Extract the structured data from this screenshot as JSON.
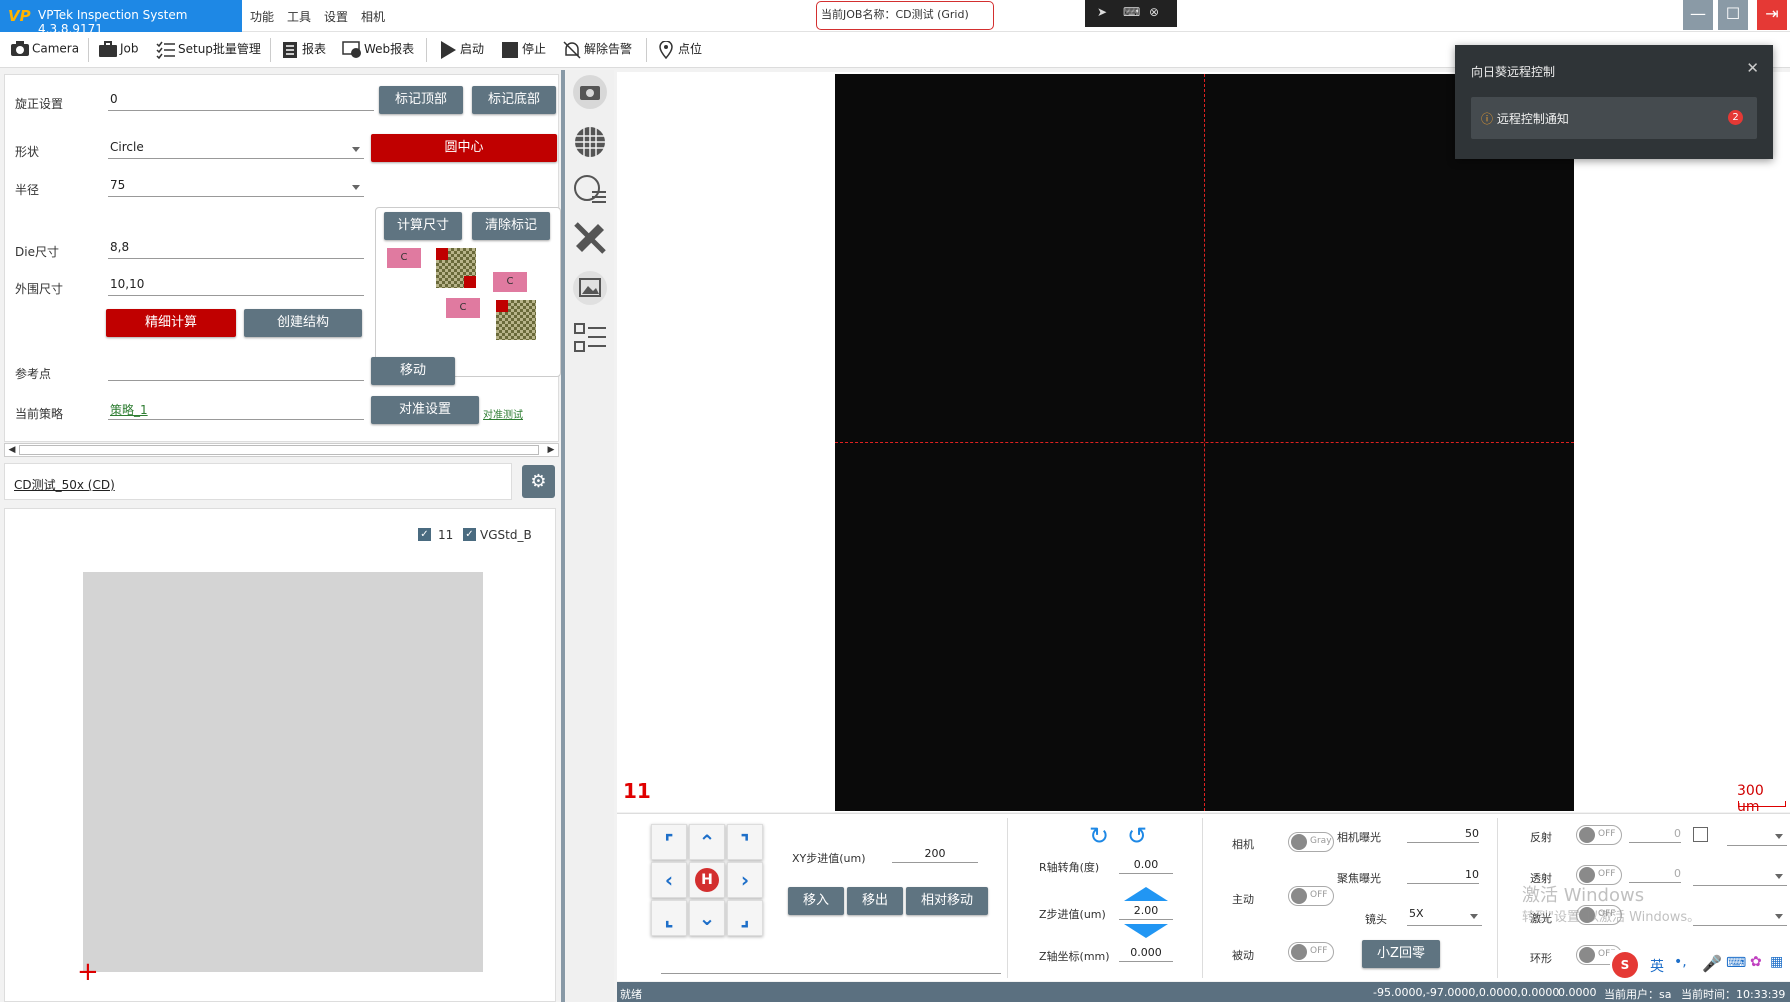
{
  "app": {
    "title": "VPTek Inspection System 4.3.8.9171",
    "logo": "VP",
    "menu": [
      "功能",
      "工具",
      "设置",
      "相机"
    ],
    "job_name": "当前JOB名称：CD测试 (Grid)"
  },
  "toolbar": {
    "items": [
      {
        "label": "Camera",
        "icon": "camera-icon"
      },
      {
        "label": "Job",
        "icon": "briefcase-icon"
      },
      {
        "label": "Setup批量管理",
        "icon": "checklist-icon"
      },
      {
        "label": "报表",
        "icon": "report-icon"
      },
      {
        "label": "Web报表",
        "icon": "web-report-icon"
      },
      {
        "label": "启动",
        "icon": "play-icon"
      },
      {
        "label": "停止",
        "icon": "stop-icon"
      },
      {
        "label": "解除告警",
        "icon": "bell-off-icon"
      },
      {
        "label": "点位",
        "icon": "map-pin-icon"
      }
    ]
  },
  "settings": {
    "rotation_label": "旋正设置",
    "rotation_value": "0",
    "mark_top": "标记顶部",
    "mark_bottom": "标记底部",
    "shape_label": "形状",
    "shape_value": "Circle",
    "circle_center": "圆中心",
    "radius_label": "半径",
    "radius_value": "75",
    "calc_size": "计算尺寸",
    "clear_marks": "清除标记",
    "die_label": "Die尺寸",
    "die_value": "8,8",
    "outer_label": "外围尺寸",
    "outer_value": "10,10",
    "fine_calc": "精细计算",
    "create_struct": "创建结构",
    "ref_label": "参考点",
    "ref_value": "",
    "move": "移动",
    "strategy_label": "当前策略",
    "strategy_value": "策略_1",
    "align_settings": "对准设置",
    "align_test": "对准测试",
    "diagram_tag": "C"
  },
  "recipe": {
    "path": "CD测试_50x (CD)"
  },
  "map": {
    "checkboxes": [
      {
        "label": "11",
        "checked": true
      },
      {
        "label": "VGStd_B",
        "checked": true
      }
    ]
  },
  "camera": {
    "site_number": "11",
    "scale_label": "300 um"
  },
  "notification": {
    "title": "向日葵远程控制",
    "item": "远程控制通知",
    "count": "2"
  },
  "motion": {
    "xy_step_label": "XY步进值(um)",
    "xy_step_value": "200",
    "move_in": "移入",
    "move_out": "移出",
    "relative_move": "相对移动",
    "r_angle_label": "R轴转角(度)",
    "r_angle_value": "0.00",
    "z_step_label": "Z步进值(um)",
    "z_step_value": "2.00",
    "z_coord_label": "Z轴坐标(mm)",
    "z_coord_value": "0.000",
    "home": "H"
  },
  "camera_ctrl": {
    "camera_label": "相机",
    "camera_toggle": "Gray",
    "active_label": "主动",
    "active_toggle": "OFF",
    "passive_label": "被动",
    "passive_toggle": "OFF",
    "exposure_label": "相机曝光",
    "exposure_value": "50",
    "focus_exposure_label": "聚焦曝光",
    "focus_exposure_value": "10",
    "lens_label": "镜头",
    "lens_value": "5X",
    "small_z_zero": "小Z回零"
  },
  "lights": {
    "reflect_label": "反射",
    "reflect_toggle": "OFF",
    "reflect_value": "0",
    "transmit_label": "透射",
    "transmit_toggle": "OFF",
    "transmit_value": "0",
    "laser_label": "激光",
    "laser_toggle": "OFF",
    "ring_label": "环形",
    "ring_toggle": "OFF"
  },
  "watermark": {
    "line1": "激活 Windows",
    "line2": "转到\"设置\"以激活 Windows。"
  },
  "status": {
    "state": "就绪",
    "coords": "-95.0000,-97.0000,0.0000,0.0000",
    "zero": "0.0000",
    "user": "当前用户：sa",
    "time": "当前时间：10:33:39"
  },
  "ime": {
    "lang": "英"
  },
  "colors": {
    "accent": "#1e88e5",
    "button": "#5f7481",
    "danger": "#c00000",
    "crosshair": "#e02020"
  }
}
